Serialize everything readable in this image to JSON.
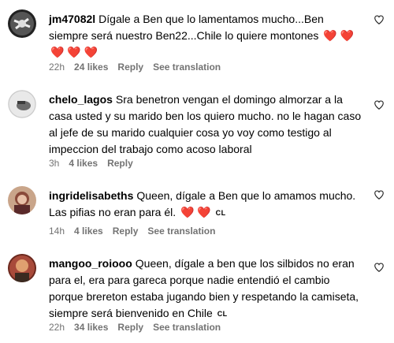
{
  "comments": [
    {
      "username": "jm47082l",
      "text": "Dígale a Ben que lo lamentamos mucho...Ben siempre será nuestro Ben22...Chile lo quiere montones",
      "hearts_inline": "❤️ ❤️",
      "hearts_line2": "❤️ ❤️ ❤️",
      "time": "22h",
      "likes": "24 likes",
      "reply": "Reply",
      "translate": "See translation"
    },
    {
      "username": "chelo_lagos",
      "text": "Sra benetron vengan el domingo almorzar a la casa usted y su marido ben los quiero mucho. no le hagan caso al jefe de su marido cualquier cosa yo voy como testigo al impeccion del trabajo como acoso laboral",
      "time": "3h",
      "likes": "4 likes",
      "reply": "Reply"
    },
    {
      "username": "ingridelisabeths",
      "text": "Queen, dígale a Ben que lo amamos mucho. Las pifias no eran para él.",
      "hearts_inline": "❤️ ❤️",
      "badge": "CL",
      "time": "14h",
      "likes": "4 likes",
      "reply": "Reply",
      "translate": "See translation"
    },
    {
      "username": "mangoo_roiooo",
      "text": "Queen, dígale a ben que los silbidos no eran para el, era para gareca porque nadie entendió el cambio porque brereton estaba jugando bien y respetando la camiseta, siempre será bienvenido en Chile",
      "badge": "CL",
      "time": "22h",
      "likes": "34 likes",
      "reply": "Reply",
      "translate": "See translation"
    }
  ],
  "colors": {
    "meta": "#737373",
    "heart": "#ed1c24"
  }
}
